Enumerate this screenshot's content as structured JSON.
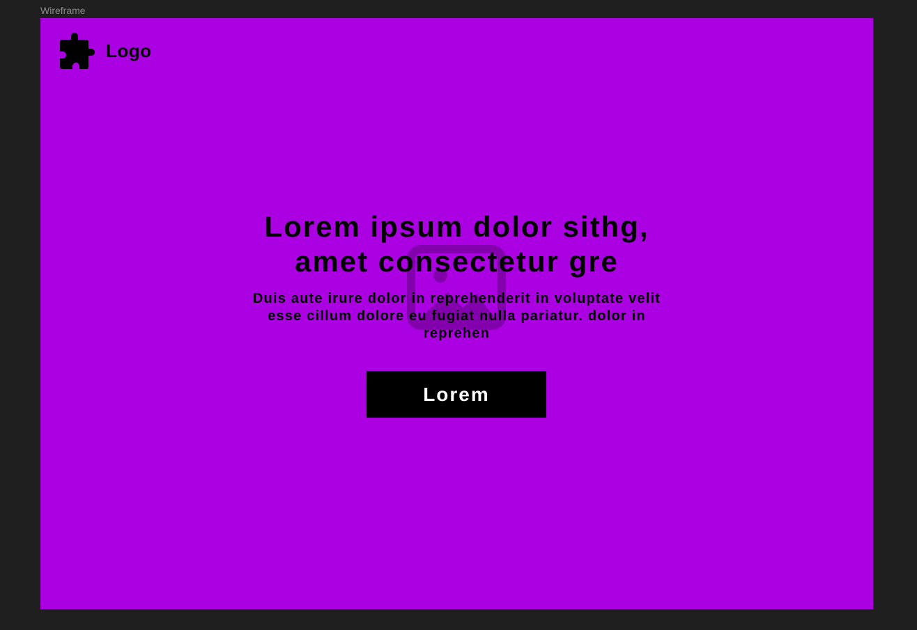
{
  "frame_label": "Wireframe",
  "colors": {
    "canvas_bg": "#1f1f1f",
    "frame_bg": "#aa00e2",
    "text": "#000000",
    "button_bg": "#000000",
    "button_text": "#ffffff"
  },
  "logo": {
    "icon": "puzzle-piece-icon",
    "text": "Logo"
  },
  "hero": {
    "title_line1": "Lorem ipsum dolor sithg,",
    "title_line2": "amet consectetur  gre",
    "subtitle": "Duis aute irure dolor in reprehenderit in voluptate velit esse cillum dolore eu fugiat nulla pariatur.  dolor in reprehen",
    "image_placeholder_icon": "image-icon"
  },
  "cta": {
    "label": "Lorem"
  }
}
